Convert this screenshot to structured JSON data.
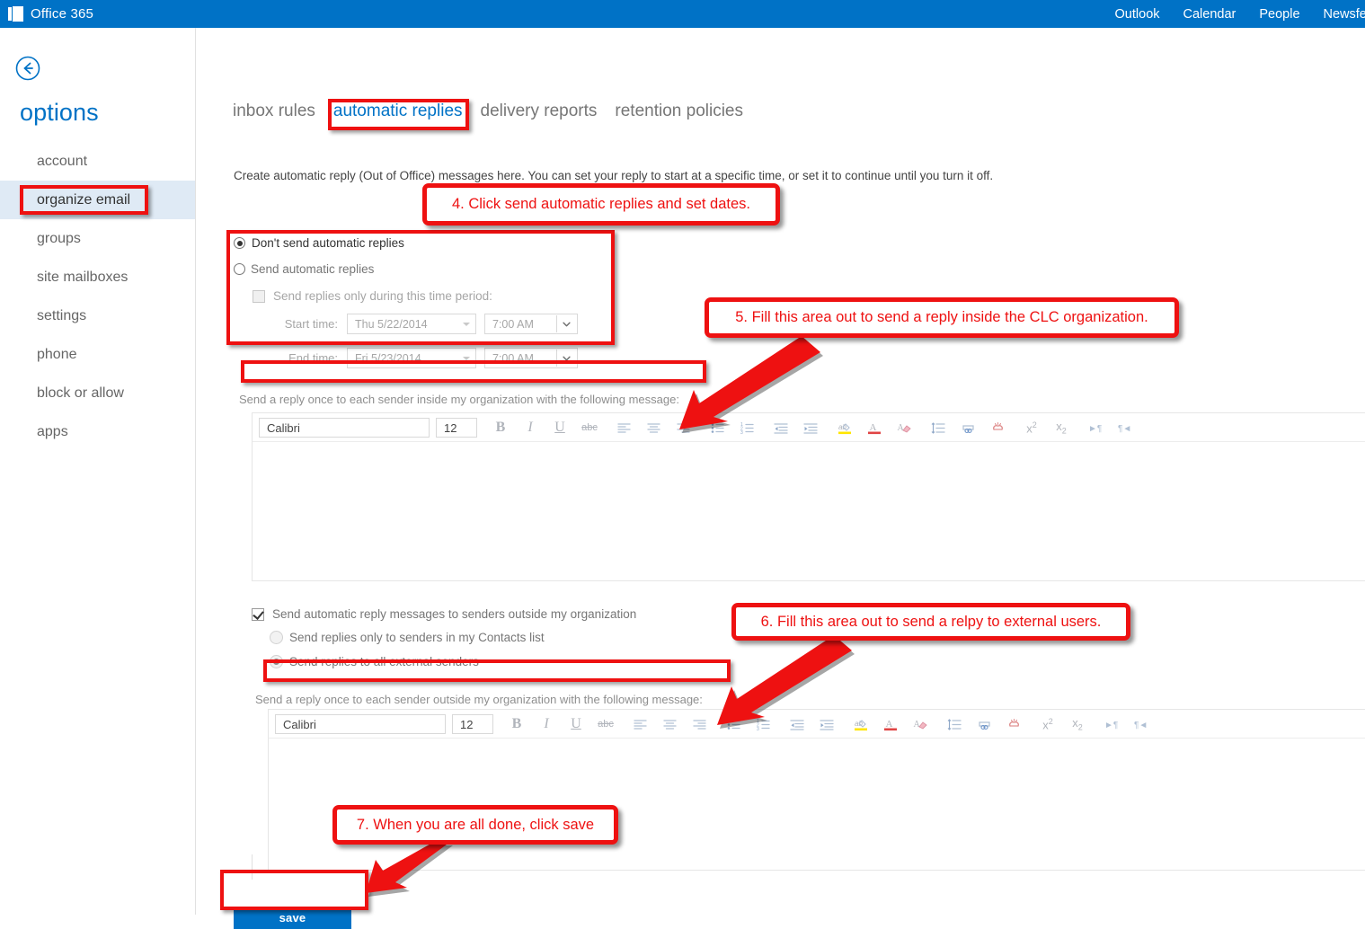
{
  "suite": {
    "brand": "Office 365",
    "logo_icon": "office-logo-icon",
    "nav": [
      {
        "label": "Outlook"
      },
      {
        "label": "Calendar"
      },
      {
        "label": "People"
      },
      {
        "label": "Newsfeed"
      }
    ]
  },
  "sidebar": {
    "back_icon": "back-circle-arrow-icon",
    "title": "options",
    "items": [
      {
        "label": "account",
        "selected": false
      },
      {
        "label": "organize email",
        "selected": true
      },
      {
        "label": "groups",
        "selected": false
      },
      {
        "label": "site mailboxes",
        "selected": false
      },
      {
        "label": "settings",
        "selected": false
      },
      {
        "label": "phone",
        "selected": false
      },
      {
        "label": "block or allow",
        "selected": false
      },
      {
        "label": "apps",
        "selected": false
      }
    ]
  },
  "main": {
    "tabs": [
      {
        "label": "inbox rules",
        "active": false
      },
      {
        "label": "automatic replies",
        "active": true
      },
      {
        "label": "delivery reports",
        "active": false
      },
      {
        "label": "retention policies",
        "active": false
      }
    ],
    "intro": "Create automatic reply (Out of Office) messages here. You can set your reply to start at a specific time, or set it to continue until you turn it off.",
    "reply_mode": {
      "dont_send_label": "Don't send automatic replies",
      "dont_send_selected": true,
      "send_label": "Send automatic replies",
      "send_selected": false
    },
    "time_period": {
      "checkbox_label": "Send replies only during this time period:",
      "checked": false,
      "start_label": "Start time:",
      "start_date": "Thu 5/22/2014",
      "start_time": "7:00 AM",
      "end_label": "End time:",
      "end_date": "Fri 5/23/2014",
      "end_time": "7:00 AM"
    },
    "internal": {
      "label": "Send a reply once to each sender inside my organization with the following message:",
      "font_name": "Calibri",
      "font_size": "12",
      "body": ""
    },
    "external": {
      "checkbox_label": "Send automatic reply messages to senders outside my organization",
      "checked": true,
      "option_contacts": "Send replies only to senders in my Contacts list",
      "option_contacts_selected": false,
      "option_all": "Send replies to all external senders",
      "option_all_selected": true,
      "label": "Send a reply once to each sender outside my organization with the following message:",
      "font_name": "Calibri",
      "font_size": "12",
      "body": ""
    },
    "save_label": "save"
  },
  "toolbar_icons": [
    {
      "name": "bold-icon",
      "glyph": "B"
    },
    {
      "name": "italic-icon",
      "glyph": "I"
    },
    {
      "name": "underline-icon",
      "glyph": "U"
    },
    {
      "name": "strikethrough-icon",
      "glyph": "abc"
    },
    {
      "name": "align-left-icon",
      "glyph": ""
    },
    {
      "name": "align-center-icon",
      "glyph": ""
    },
    {
      "name": "align-right-icon",
      "glyph": ""
    },
    {
      "name": "bulleted-list-icon",
      "glyph": ""
    },
    {
      "name": "numbered-list-icon",
      "glyph": ""
    },
    {
      "name": "decrease-indent-icon",
      "glyph": ""
    },
    {
      "name": "increase-indent-icon",
      "glyph": ""
    },
    {
      "name": "highlight-color-icon",
      "glyph": ""
    },
    {
      "name": "font-color-icon",
      "glyph": "A"
    },
    {
      "name": "clear-formatting-icon",
      "glyph": ""
    },
    {
      "name": "line-spacing-icon",
      "glyph": ""
    },
    {
      "name": "insert-link-icon",
      "glyph": ""
    },
    {
      "name": "remove-link-icon",
      "glyph": ""
    },
    {
      "name": "superscript-icon",
      "glyph": "x"
    },
    {
      "name": "subscript-icon",
      "glyph": "x"
    },
    {
      "name": "ltr-direction-icon",
      "glyph": ""
    },
    {
      "name": "rtl-direction-icon",
      "glyph": ""
    }
  ],
  "annotations": {
    "accent_color": "#ee1111",
    "callouts": [
      {
        "id": "step-4",
        "text": "4. Click send automatic replies and set dates."
      },
      {
        "id": "step-5",
        "text": "5. Fill this area out to send a reply inside the CLC organization."
      },
      {
        "id": "step-6",
        "text": "6. Fill this area out to send a relpy to external users."
      },
      {
        "id": "step-7",
        "text": "7. When you are all done, click save"
      }
    ],
    "highlight_boxes": [
      {
        "id": "organize-email-highlight"
      },
      {
        "id": "automatic-replies-tab-highlight"
      },
      {
        "id": "time-period-block-highlight"
      },
      {
        "id": "internal-message-label-highlight"
      },
      {
        "id": "external-message-label-highlight"
      },
      {
        "id": "save-button-highlight"
      }
    ]
  }
}
